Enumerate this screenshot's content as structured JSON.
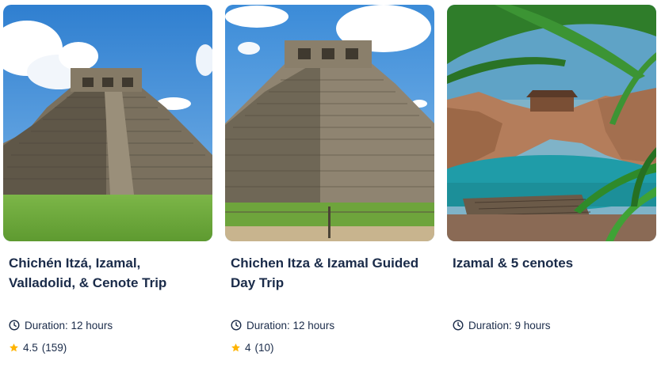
{
  "cards": [
    {
      "title": "Chichén Itzá, Izamal, Valladolid, & Cenote Trip",
      "duration": "Duration: 12 hours",
      "rating": "4.5",
      "review_count": "(159)",
      "image": "el-castillo-pyramid-grass"
    },
    {
      "title": "Chichen Itza & Izamal Guided Day Trip",
      "duration": "Duration: 12 hours",
      "rating": "4",
      "review_count": "(10)",
      "image": "el-castillo-pyramid-closeup"
    },
    {
      "title": "Izamal & 5 cenotes",
      "duration": "Duration: 9 hours",
      "image": "cenote-with-palm-leaves"
    }
  ],
  "colors": {
    "text": "#1a2b49",
    "star": "#ffb400",
    "sky": "#3d8fd6",
    "grass": "#6aa53c",
    "stone": "#8b8170",
    "water": "#1c9aa6"
  },
  "icons": {
    "duration": "clock-icon",
    "rating": "star-icon"
  }
}
